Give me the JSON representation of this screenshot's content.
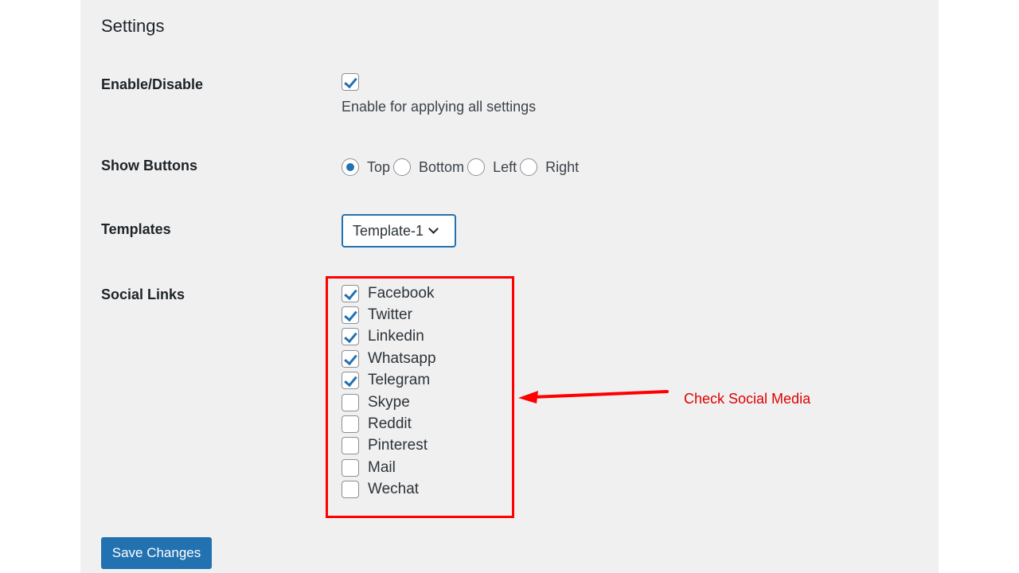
{
  "page": {
    "title": "Settings"
  },
  "enable": {
    "label": "Enable/Disable",
    "checked": true,
    "description": "Enable for applying all settings"
  },
  "show_buttons": {
    "label": "Show Buttons",
    "options": [
      {
        "label": "Top",
        "selected": true
      },
      {
        "label": "Bottom",
        "selected": false
      },
      {
        "label": "Left",
        "selected": false
      },
      {
        "label": "Right",
        "selected": false
      }
    ]
  },
  "templates": {
    "label": "Templates",
    "selected": "Template-1",
    "icon": "chevron-down-icon"
  },
  "social_links": {
    "label": "Social Links",
    "items": [
      {
        "label": "Facebook",
        "checked": true
      },
      {
        "label": "Twitter",
        "checked": true
      },
      {
        "label": "Linkedin",
        "checked": true
      },
      {
        "label": "Whatsapp",
        "checked": true
      },
      {
        "label": "Telegram",
        "checked": true
      },
      {
        "label": "Skype",
        "checked": false
      },
      {
        "label": "Reddit",
        "checked": false
      },
      {
        "label": "Pinterest",
        "checked": false
      },
      {
        "label": "Mail",
        "checked": false
      },
      {
        "label": "Wechat",
        "checked": false
      }
    ]
  },
  "annotation": {
    "text": "Check Social Media",
    "color": "#ff0000",
    "icon": "arrow-left-icon"
  },
  "actions": {
    "save_label": "Save Changes"
  },
  "colors": {
    "accent": "#2271b1",
    "panel_bg": "#f0f0f1",
    "highlight": "#ff0000"
  }
}
